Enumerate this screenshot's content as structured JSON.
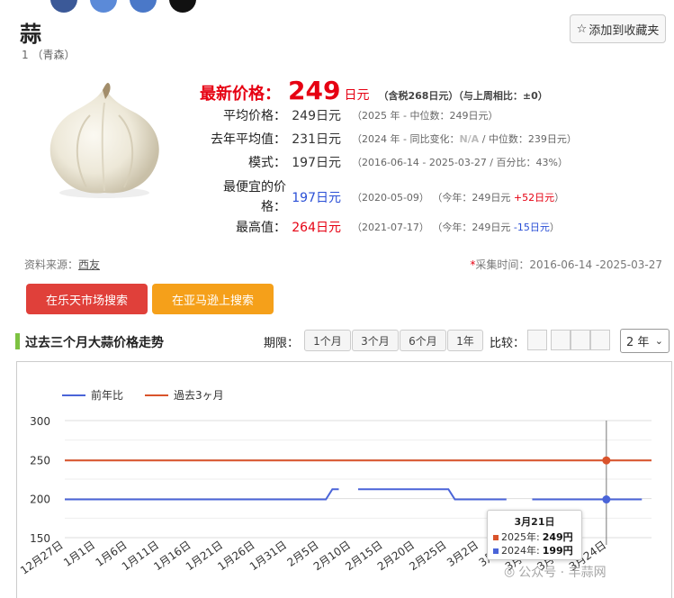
{
  "colors": {
    "accent_red": "#e60012",
    "blue": "#2a4fd6",
    "series_prev_year": "#4a64d8",
    "series_past3m": "#d9532b"
  },
  "share_icons": [
    {
      "icon": "share-circle",
      "color": "#3b5998"
    },
    {
      "icon": "share-circle",
      "color": "#5b8ad8"
    },
    {
      "icon": "share-circle",
      "color": "#4a78c8"
    },
    {
      "icon": "share-circle",
      "color": "#111111"
    }
  ],
  "product": {
    "name": "蒜",
    "sub": "1 （青森）"
  },
  "favorite_label": "添加到收藏夹",
  "latest": {
    "label": "最新价格：",
    "price": "249",
    "unit": "日元",
    "note": "（含税268日元）（与上周相比：±0）"
  },
  "stats": [
    {
      "label": "平均价格：",
      "value": "249日元",
      "meta": [
        {
          "t": "（2025 年 - 中位数：249日元）"
        }
      ]
    },
    {
      "label": "去年平均值：",
      "value": "231日元",
      "meta": [
        {
          "t": "（2024 年 - 同比变化："
        },
        {
          "t": "N/A",
          "c": "na"
        },
        {
          "t": " / 中位数：239日元）"
        }
      ]
    },
    {
      "label": "模式：",
      "value": "197日元",
      "meta": [
        {
          "t": "（2016-06-14 - 2025-03-27 / 百分比：43%）"
        }
      ]
    },
    {
      "label": "最便宜的价格：",
      "value": "197日元",
      "meta": [
        {
          "t": "（2020-05-09）   （今年：249日元 "
        },
        {
          "t": "+52日元",
          "c": "plus"
        },
        {
          "t": "）"
        }
      ]
    },
    {
      "label": "最高值：",
      "value": "264日元",
      "meta": [
        {
          "t": "（2021-07-17）   （今年：249日元 "
        },
        {
          "t": "-15日元",
          "c": "minus"
        },
        {
          "t": "）"
        }
      ]
    }
  ],
  "source": {
    "label": "资料来源：",
    "link": "西友"
  },
  "collect_time": {
    "star": "*",
    "text": "采集时间：2016-06-14 -2025-03-27"
  },
  "buttons": {
    "rakuten": "在乐天市场搜索",
    "amazon": "在亚马逊上搜索"
  },
  "section_title": "过去三个月大蒜价格走势",
  "period": {
    "label": "期限：",
    "options": [
      "1个月",
      "3个月",
      "6个月",
      "1年"
    ]
  },
  "compare_label": "比较：",
  "compare_selected_index": 1,
  "year_select": "2 年",
  "chart_data": {
    "type": "line",
    "legend": [
      "前年比",
      "過去3ヶ月"
    ],
    "legend_position": "top-left",
    "grid": true,
    "yticks": [
      150,
      200,
      250,
      300
    ],
    "ylim": [
      150,
      300
    ],
    "xticks": [
      "12月27日",
      "1月1日",
      "1月6日",
      "1月11日",
      "1月16日",
      "1月21日",
      "1月26日",
      "1月31日",
      "2月5日",
      "2月10日",
      "2月15日",
      "2月20日",
      "2月25日",
      "3月2日",
      "3月7日",
      "3月12日",
      "3月17日",
      "3月24日"
    ],
    "xlim_days": [
      0,
      91
    ],
    "series": [
      {
        "name": "過去3ヶ月",
        "points": [
          [
            0,
            249
          ],
          [
            91,
            249
          ]
        ]
      },
      {
        "name": "前年比",
        "segments": [
          [
            [
              0,
              199
            ],
            [
              40.5,
              199
            ],
            [
              41.5,
              212
            ],
            [
              42.5,
              212
            ]
          ],
          [
            [
              45.5,
              212
            ],
            [
              59.5,
              212
            ],
            [
              60.5,
              199
            ],
            [
              68.5,
              199
            ]
          ],
          [
            [
              72.5,
              199
            ],
            [
              89.5,
              199
            ]
          ]
        ]
      }
    ],
    "cursor_day": 84,
    "tooltip": {
      "title": "3月21日",
      "rows": [
        {
          "label": "2025年: ",
          "value": "249円"
        },
        {
          "label": "2024年: ",
          "value": "199円"
        }
      ]
    }
  },
  "watermark": "公众号 · 丰蒜网"
}
